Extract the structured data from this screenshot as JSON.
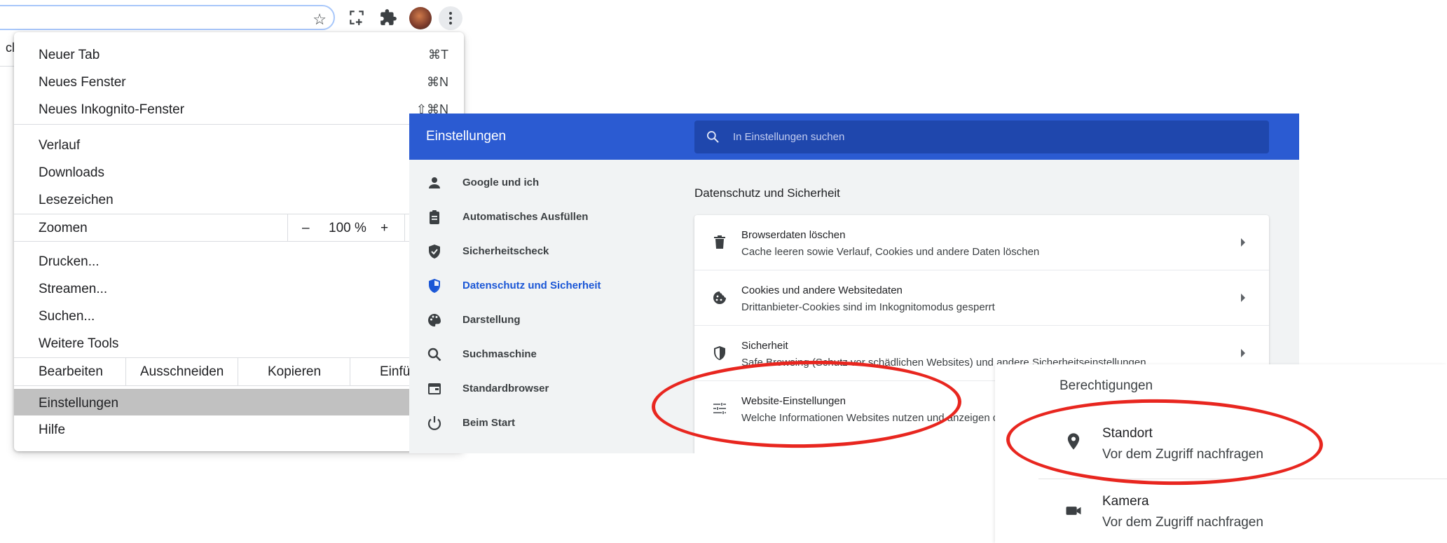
{
  "menu": {
    "new_tab": {
      "label": "Neuer Tab",
      "shortcut": "⌘T"
    },
    "new_window": {
      "label": "Neues Fenster",
      "shortcut": "⌘N"
    },
    "new_incognito": {
      "label": "Neues Inkognito-Fenster",
      "shortcut": "⇧⌘N"
    },
    "history": "Verlauf",
    "downloads": "Downloads",
    "bookmarks": "Lesezeichen",
    "zoom": {
      "label": "Zoomen",
      "minus": "–",
      "value": "100 %",
      "plus": "+"
    },
    "print": "Drucken...",
    "cast": "Streamen...",
    "find": "Suchen...",
    "more_tools": "Weitere Tools",
    "edit": {
      "label": "Bearbeiten",
      "cut": "Ausschneiden",
      "copy": "Kopieren",
      "paste": "Einfü"
    },
    "settings": "Einstellungen",
    "help": "Hilfe"
  },
  "page_edge_text": "cl",
  "settings": {
    "title": "Einstellungen",
    "search_placeholder": "In Einstellungen suchen",
    "nav": [
      {
        "label": "Google und ich",
        "icon": "person-icon"
      },
      {
        "label": "Automatisches Ausfüllen",
        "icon": "clipboard-icon"
      },
      {
        "label": "Sicherheitscheck",
        "icon": "shield-check-icon"
      },
      {
        "label": "Datenschutz und Sicherheit",
        "icon": "shield-privacy-icon",
        "active": true
      },
      {
        "label": "Darstellung",
        "icon": "palette-icon"
      },
      {
        "label": "Suchmaschine",
        "icon": "search-icon"
      },
      {
        "label": "Standardbrowser",
        "icon": "browser-window-icon"
      },
      {
        "label": "Beim Start",
        "icon": "power-icon"
      }
    ],
    "section_title": "Datenschutz und Sicherheit",
    "rows": [
      {
        "title": "Browserdaten löschen",
        "subtitle": "Cache leeren sowie Verlauf, Cookies und andere Daten löschen",
        "icon": "trash-icon"
      },
      {
        "title": "Cookies und andere Websitedaten",
        "subtitle": "Drittanbieter-Cookies sind im Inkognitomodus gesperrt",
        "icon": "cookie-icon"
      },
      {
        "title": "Sicherheit",
        "subtitle": "Safe Browsing (Schutz vor schädlichen Websites) und andere Sicherheitseinstellungen",
        "icon": "shield-icon"
      },
      {
        "title": "Website-Einstellungen",
        "subtitle": "Welche Informationen Websites nutzen und anzeigen dürfen",
        "icon": "tune-icon"
      }
    ]
  },
  "permissions": {
    "title": "Berechtigungen",
    "items": [
      {
        "title": "Standort",
        "subtitle": "Vor dem Zugriff nachfragen",
        "icon": "location-pin-icon"
      },
      {
        "title": "Kamera",
        "subtitle": "Vor dem Zugriff nachfragen",
        "icon": "camera-icon"
      }
    ]
  },
  "colors": {
    "settings_header": "#2b5bd2",
    "search_box": "#1f47ad",
    "active_nav": "#1a56d6",
    "highlight_ellipse": "#e8261f",
    "menu_highlight": "#c1c1c1"
  }
}
